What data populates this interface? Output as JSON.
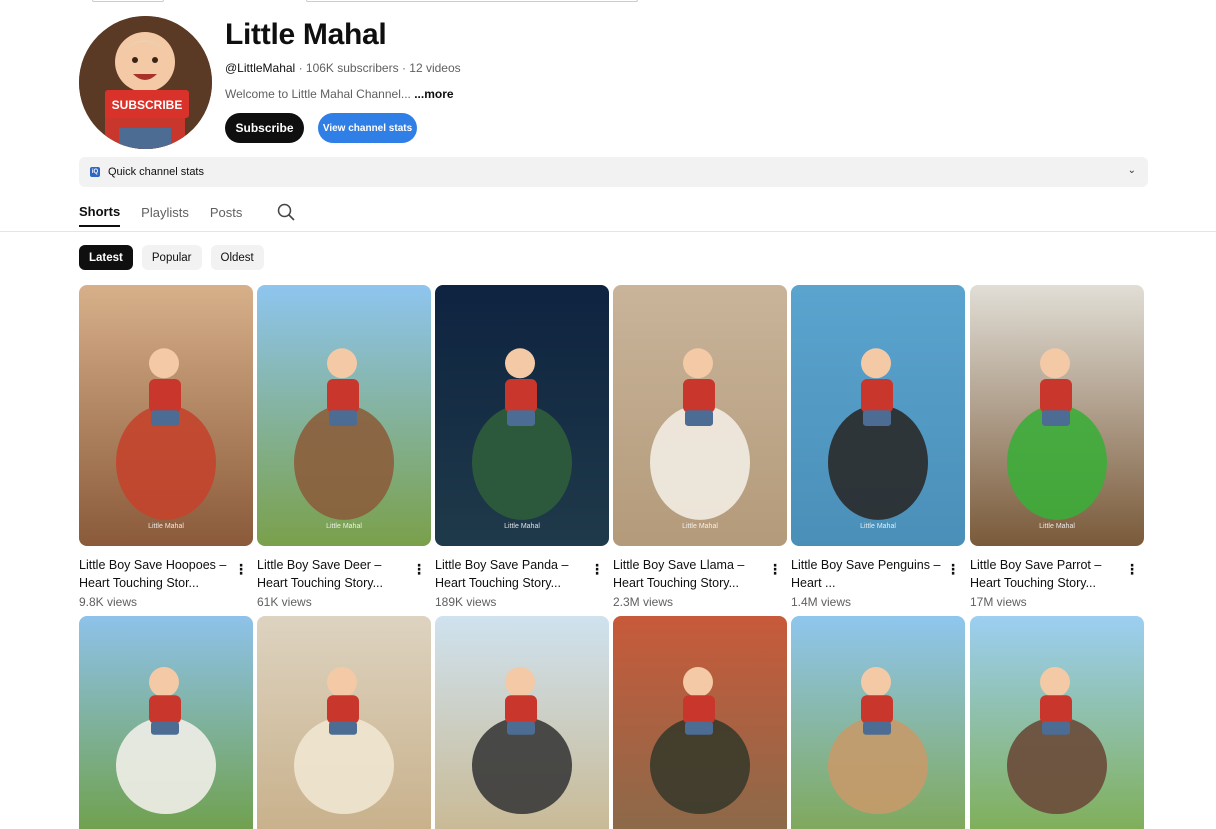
{
  "channel": {
    "name": "Little Mahal",
    "handle": "@LittleMahal",
    "subscribers": "· 106K subscribers",
    "videos": "· 12 videos",
    "description": "Welcome to Little Mahal Channel...",
    "more_label": "...more",
    "avatar_badge": "SUBSCRIBE"
  },
  "buttons": {
    "subscribe": "Subscribe",
    "view_stats": "View channel stats"
  },
  "quick_stats": {
    "label": "Quick channel stats",
    "icon_text": "iQ"
  },
  "tabs": [
    {
      "label": "Shorts",
      "active": true
    },
    {
      "label": "Playlists",
      "active": false
    },
    {
      "label": "Posts",
      "active": false
    }
  ],
  "chips": [
    {
      "label": "Latest",
      "active": true
    },
    {
      "label": "Popular",
      "active": false
    },
    {
      "label": "Oldest",
      "active": false
    }
  ],
  "watermark": "Little Mahal",
  "videos": [
    {
      "title": "Little Boy Save Hoopoes – Heart Touching Stor...",
      "views": "9.8K views",
      "bg": "#8a5a3a",
      "accent": "#c4442c",
      "sky": "#d7b08a"
    },
    {
      "title": "Little Boy Save Deer – Heart Touching Story...",
      "views": "61K views",
      "bg": "#7aa04a",
      "accent": "#8b5e3c",
      "sky": "#8ec5ef"
    },
    {
      "title": "Little Boy Save Panda – Heart Touching Story...",
      "views": "189K views",
      "bg": "#1f3a4a",
      "accent": "#2f5d3a",
      "sky": "#0e2340"
    },
    {
      "title": "Little Boy Save Llama – Heart Touching Story...",
      "views": "2.3M views",
      "bg": "#b39a7a",
      "accent": "#f2ece2",
      "sky": "#c9b49a"
    },
    {
      "title": "Little Boy Save Penguins – Heart ...",
      "views": "1.4M views",
      "bg": "#4a8fb8",
      "accent": "#2a2a2a",
      "sky": "#5aa4cf"
    },
    {
      "title": "Little Boy Save Parrot – Heart Touching Story...",
      "views": "17M views",
      "bg": "#7a5a3a",
      "accent": "#3cad3a",
      "sky": "#e1ded6"
    },
    {
      "title": "",
      "views": "",
      "bg": "#6fa04a",
      "accent": "#f1eee8",
      "sky": "#8ec2ea"
    },
    {
      "title": "",
      "views": "",
      "bg": "#c8b08a",
      "accent": "#efe6d0",
      "sky": "#ddd3c0"
    },
    {
      "title": "",
      "views": "",
      "bg": "#c9b993",
      "accent": "#3a3a3a",
      "sky": "#cfe2ef"
    },
    {
      "title": "",
      "views": "",
      "bg": "#8a6a4a",
      "accent": "#3a3a2a",
      "sky": "#c75a3a"
    },
    {
      "title": "",
      "views": "",
      "bg": "#7fa858",
      "accent": "#c79a6a",
      "sky": "#8fc6ee"
    },
    {
      "title": "",
      "views": "",
      "bg": "#7fae55",
      "accent": "#6a4a3a",
      "sky": "#9ccff2"
    }
  ],
  "colors": {
    "accent_blue": "#2f7fe6",
    "dark": "#0f0f0f",
    "muted": "#606060",
    "boy_shirt": "#c9372c"
  },
  "icons": [
    "search-icon",
    "more-vert-icon",
    "chevron-down-icon"
  ]
}
